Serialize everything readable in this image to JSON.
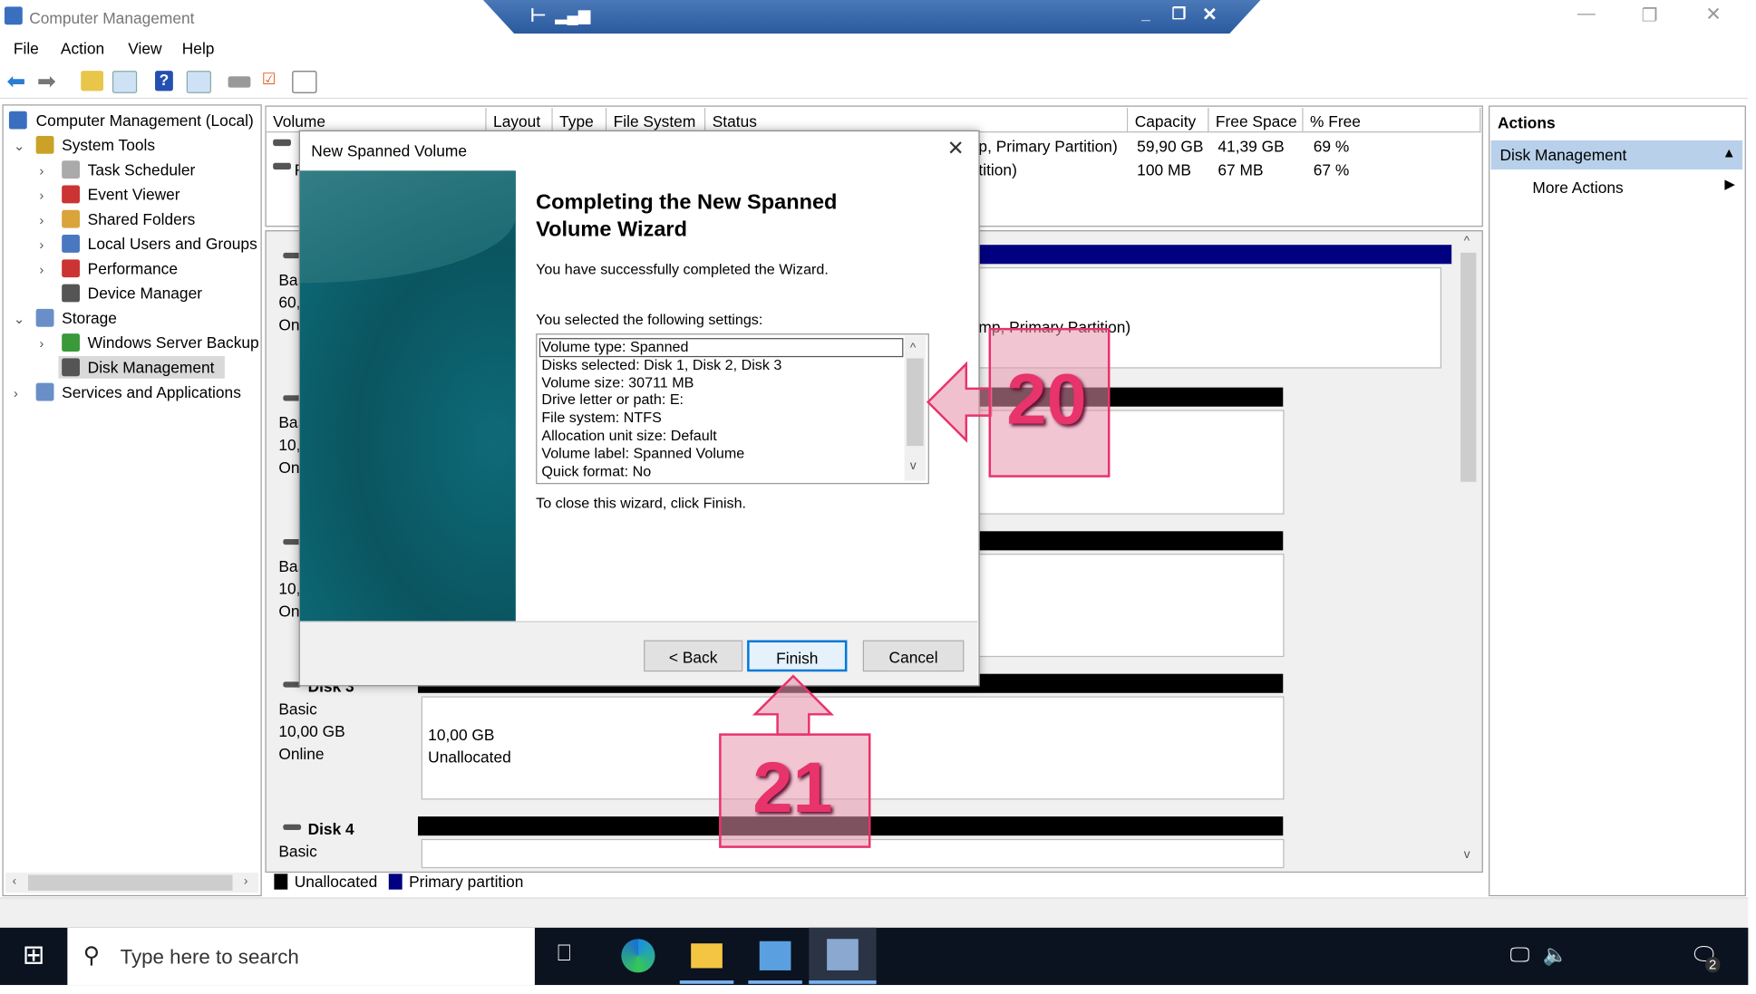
{
  "window": {
    "title": "Computer Management",
    "controls": [
      "minimize",
      "restore",
      "close"
    ]
  },
  "menu": [
    "File",
    "Action",
    "View",
    "Help"
  ],
  "toolbar": [
    "back-icon",
    "forward-icon",
    "up-folder-icon",
    "show-hide-console-tree-icon",
    "help-icon",
    "show-action-pane-icon",
    "connect-icon",
    "check-icon",
    "properties-icon"
  ],
  "tree": {
    "root": "Computer Management (Local)",
    "items": [
      {
        "label": "System Tools",
        "level": 1,
        "expanded": true
      },
      {
        "label": "Task Scheduler",
        "level": 2
      },
      {
        "label": "Event Viewer",
        "level": 2
      },
      {
        "label": "Shared Folders",
        "level": 2
      },
      {
        "label": "Local Users and Groups",
        "level": 2
      },
      {
        "label": "Performance",
        "level": 2
      },
      {
        "label": "Device Manager",
        "level": 2
      },
      {
        "label": "Storage",
        "level": 1,
        "expanded": true
      },
      {
        "label": "Windows Server Backup",
        "level": 2
      },
      {
        "label": "Disk Management",
        "level": 2,
        "selected": true
      },
      {
        "label": "Services and Applications",
        "level": 1
      }
    ]
  },
  "volume_list": {
    "columns": [
      "Volume",
      "Layout",
      "Type",
      "File System",
      "Status",
      "Capacity",
      "Free Space",
      "% Free"
    ],
    "rows": [
      {
        "volume": "",
        "status": "p, Primary Partition)",
        "capacity": "59,90 GB",
        "free": "41,39 GB",
        "pct": "69 %"
      },
      {
        "volume": "F",
        "status": "tition)",
        "capacity": "100 MB",
        "free": "67 MB",
        "pct": "67 %"
      }
    ]
  },
  "disks": [
    {
      "name": "",
      "lines": [
        "Bas",
        "60,",
        "On"
      ],
      "partition_text": "mp, Primary Partition)"
    },
    {
      "name": "",
      "lines": [
        "Bas",
        "10,",
        "On"
      ]
    },
    {
      "name": "",
      "lines": [
        "Bas",
        "10,",
        "On"
      ]
    },
    {
      "name": "Disk 3",
      "lines": [
        "Basic",
        "10,00 GB",
        "Online"
      ],
      "partition": [
        "10,00 GB",
        "Unallocated"
      ]
    },
    {
      "name": "Disk 4",
      "lines": [
        "Basic"
      ]
    }
  ],
  "legend": [
    {
      "label": "Unallocated",
      "color": "#000000"
    },
    {
      "label": "Primary partition",
      "color": "#000080"
    }
  ],
  "actions": {
    "header": "Actions",
    "section": "Disk Management",
    "item": "More Actions"
  },
  "dialog": {
    "title": "New Spanned Volume",
    "heading": "Completing the New Spanned Volume Wizard",
    "intro": "You have successfully completed the Wizard.",
    "settings_label": "You selected the following settings:",
    "settings": [
      "Volume type: Spanned",
      "Disks selected: Disk 1, Disk 2, Disk 3",
      "Volume size: 30711 MB",
      "Drive letter or path: E:",
      "File system: NTFS",
      "Allocation unit size: Default",
      "Volume label: Spanned Volume",
      "Quick format: No"
    ],
    "close_hint": "To close this wizard, click Finish.",
    "buttons": {
      "back": "< Back",
      "finish": "Finish",
      "cancel": "Cancel"
    }
  },
  "annotations": [
    "20",
    "21"
  ],
  "taskbar": {
    "search_placeholder": "Type here to search",
    "notification_count": "2"
  },
  "colors": {
    "accent": "#0078d7",
    "primary_partition": "#000080",
    "annotation": "#e8336b",
    "taskbar": "#0b1220"
  }
}
